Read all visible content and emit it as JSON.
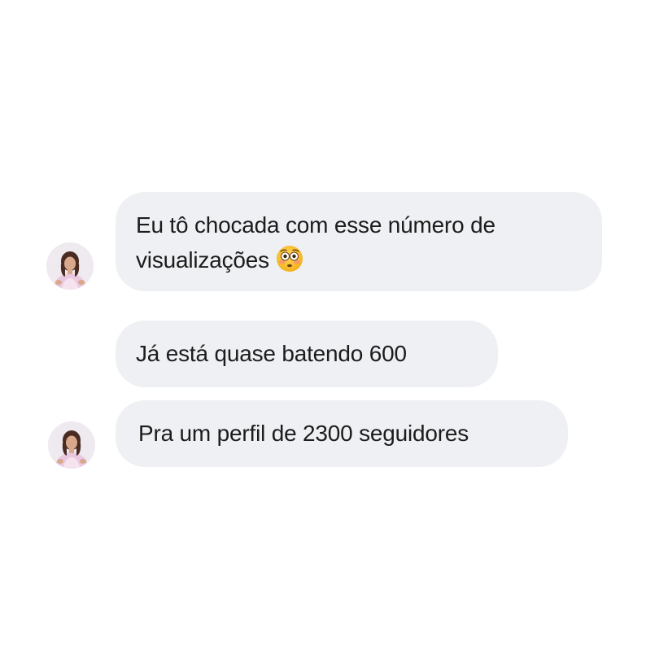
{
  "messages": [
    {
      "line1": "Eu tô chocada com esse número de",
      "line2": "visualizações",
      "emoji": "flushed-face-emoji"
    },
    {
      "text": "Já está quase batendo 600"
    },
    {
      "text": "Pra um perfil de 2300 seguidores"
    }
  ],
  "colors": {
    "bubble_bg": "#eef0f3",
    "text": "#1c1c1c",
    "background": "#ffffff"
  }
}
